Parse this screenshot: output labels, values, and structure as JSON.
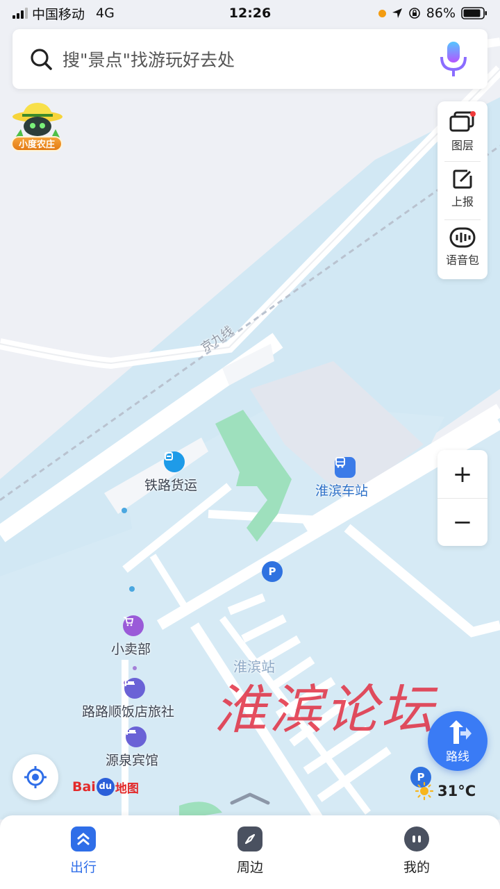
{
  "status_bar": {
    "carrier": "中国移动",
    "network": "4G",
    "time": "12:26",
    "battery": "86%"
  },
  "search": {
    "placeholder": "搜\"景点\"找游玩好去处"
  },
  "farm_badge": {
    "label": "小度农庄"
  },
  "tools": {
    "layers": "图层",
    "report": "上报",
    "voice_pack": "语音包"
  },
  "zoom": {
    "in": "+",
    "out": "−"
  },
  "map": {
    "rail_line": "京九线",
    "poi_freight": "铁路货运",
    "poi_station": "淮滨车站",
    "poi_shop": "小卖部",
    "poi_hotel1": "路路顺饭店旅社",
    "poi_hotel2": "源泉宾馆",
    "area_station": "淮滨站"
  },
  "watermark": "淮滨论坛",
  "route_button": {
    "label": "路线"
  },
  "logo": {
    "bai": "Bai",
    "du": "du",
    "map": "地图"
  },
  "weather": {
    "temperature": "31°C"
  },
  "bottom_nav": {
    "items": [
      {
        "label": "出行",
        "active": true
      },
      {
        "label": "周边",
        "active": false
      },
      {
        "label": "我的",
        "active": false
      }
    ]
  },
  "colors": {
    "accent": "#2f6ee8",
    "water": "#cfe6f3",
    "green": "#9ee0bd",
    "land": "#eef0f5"
  }
}
